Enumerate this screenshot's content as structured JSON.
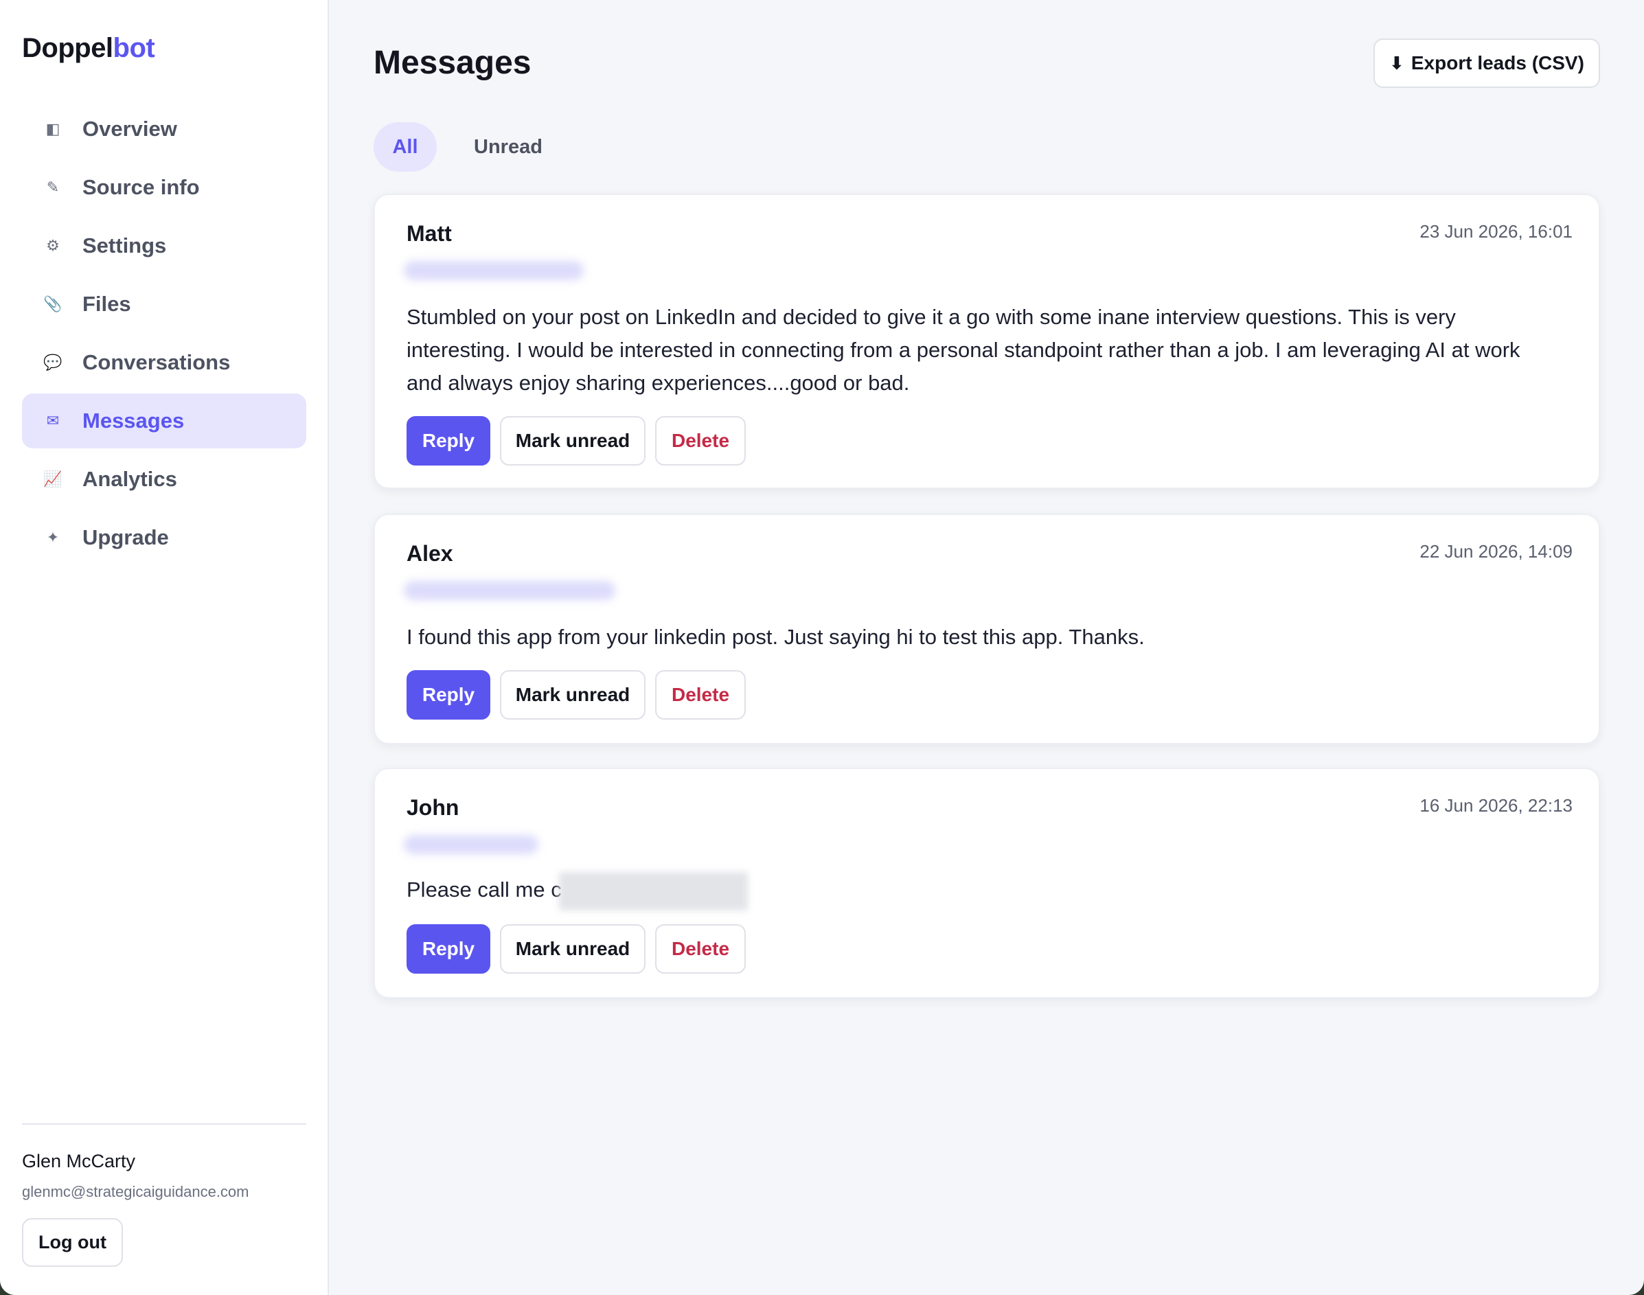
{
  "app": {
    "logo_main": "Doppel",
    "logo_accent": "bot"
  },
  "sidebar": {
    "items": [
      {
        "label": "Overview",
        "icon": "◧"
      },
      {
        "label": "Source info",
        "icon": "✎"
      },
      {
        "label": "Settings",
        "icon": "⚙"
      },
      {
        "label": "Files",
        "icon": "📎"
      },
      {
        "label": "Conversations",
        "icon": "💬"
      },
      {
        "label": "Messages",
        "icon": "✉"
      },
      {
        "label": "Analytics",
        "icon": "📈"
      },
      {
        "label": "Upgrade",
        "icon": "✦"
      }
    ],
    "active": "Messages",
    "user_name": "Glen McCarty",
    "user_email": "glenmc@strategicaiguidance.com",
    "logout_label": "Log out"
  },
  "header": {
    "title": "Messages",
    "export_label": "Export leads (CSV)",
    "export_icon": "⬇"
  },
  "tabs": [
    {
      "label": "All"
    },
    {
      "label": "Unread"
    }
  ],
  "messages": [
    {
      "name": "Matt",
      "date": "23 Jun 2026, 16:01",
      "body": "Stumbled on your post on LinkedIn and decided to give it a go with some inane interview questions. This is very interesting. I would be interested in connecting from a personal standpoint rather than a job. I am leveraging AI at work and always enjoy sharing experiences....good or bad."
    },
    {
      "name": "Alex",
      "date": "22 Jun 2026, 14:09",
      "body": "I found this app from your linkedin post. Just saying hi to test this app. Thanks."
    },
    {
      "name": "John",
      "date": "16 Jun 2026, 22:13",
      "body": "Please call me c"
    }
  ],
  "actions": {
    "reply": "Reply",
    "mark_unread": "Mark unread",
    "delete": "Delete"
  },
  "colors": {
    "accent": "#5b55f0",
    "active_bg": "#e6e5fd",
    "danger": "#c42a47"
  }
}
